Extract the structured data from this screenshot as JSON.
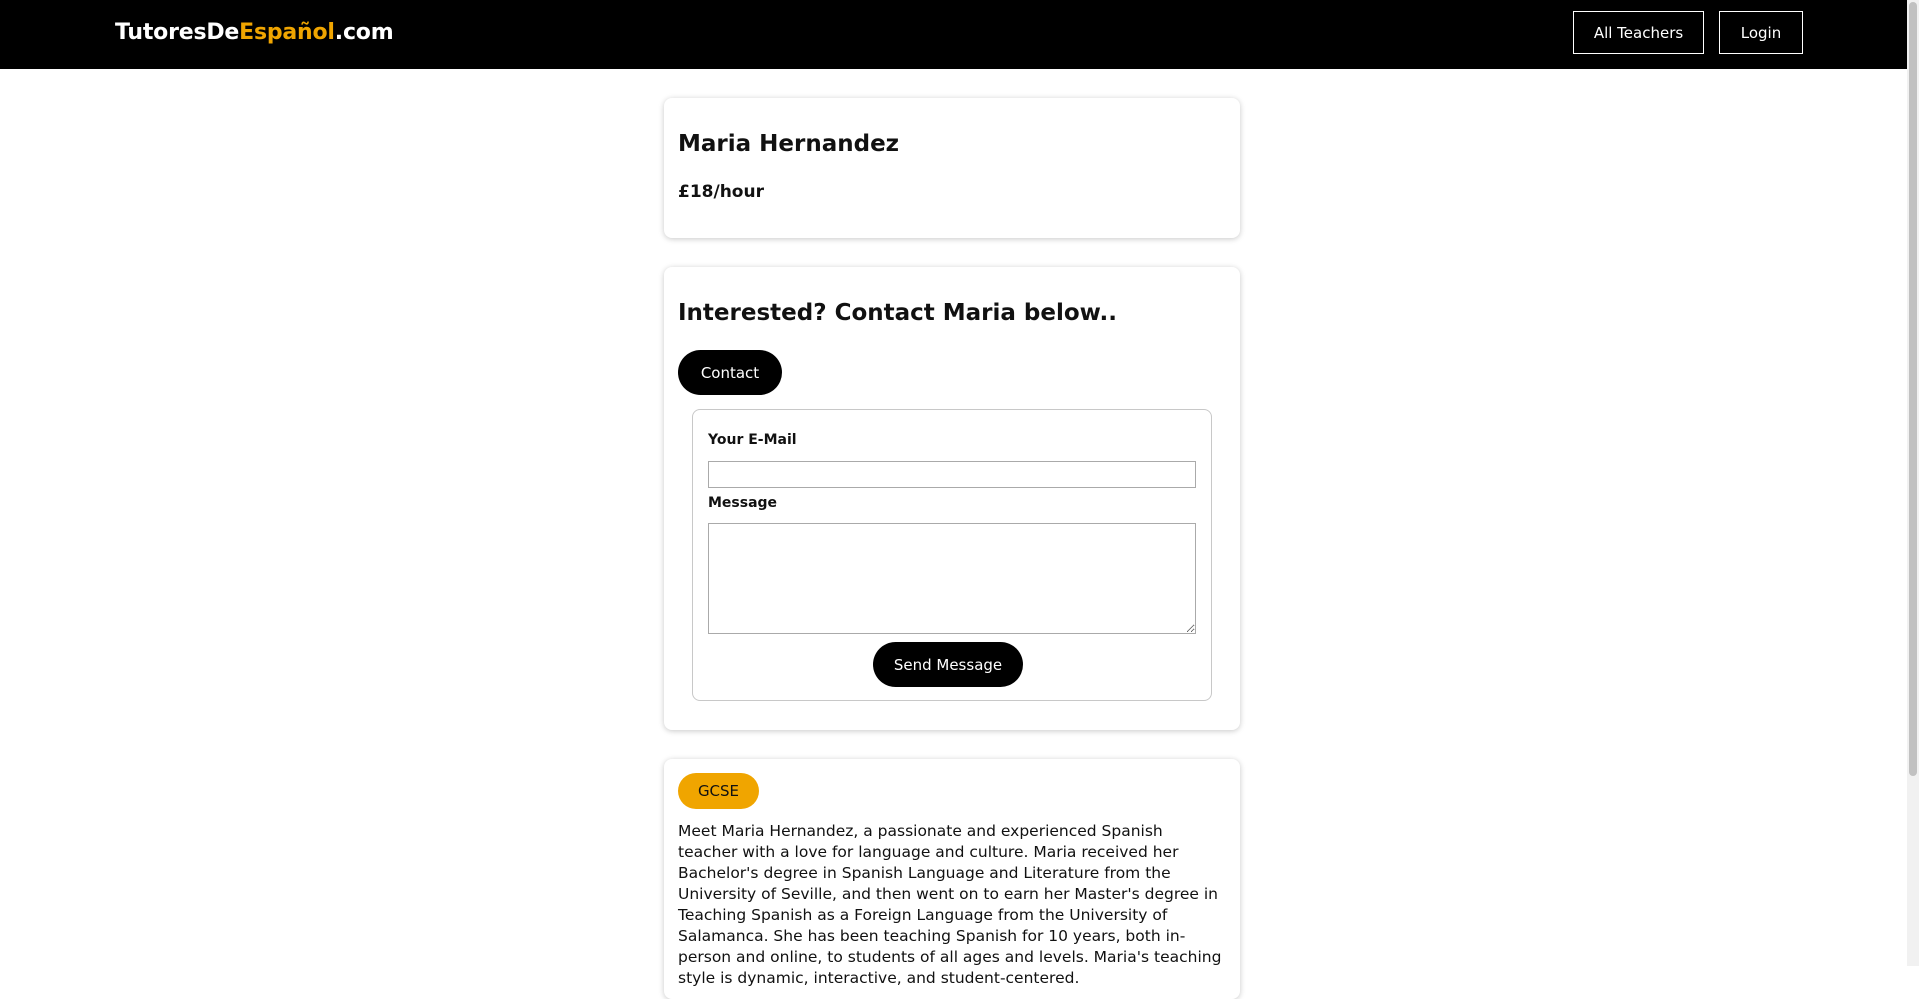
{
  "header": {
    "brand": {
      "part1": "TutoresDe",
      "part2": "Español",
      "part3": ".com"
    },
    "nav": {
      "all_teachers": "All Teachers",
      "login": "Login"
    }
  },
  "profile": {
    "name": "Maria Hernandez",
    "rate": "£18/hour"
  },
  "contact": {
    "heading": "Interested? Contact Maria below..",
    "contact_button": "Contact",
    "form": {
      "email_label": "Your E-Mail",
      "email_value": "",
      "message_label": "Message",
      "message_value": "",
      "send_button": "Send Message"
    }
  },
  "about": {
    "level_badge": "GCSE",
    "bio": "Meet Maria Hernandez, a passionate and experienced Spanish teacher with a love for language and culture. Maria received her Bachelor's degree in Spanish Language and Literature from the University of Seville, and then went on to earn her Master's degree in Teaching Spanish as a Foreign Language from the University of Salamanca. She has been teaching Spanish for 10 years, both in-person and online, to students of all ages and levels. Maria's teaching style is dynamic, interactive, and student-centered."
  },
  "colors": {
    "accent": "#f0a500",
    "header_bg": "#000000",
    "button_bg": "#000000"
  }
}
